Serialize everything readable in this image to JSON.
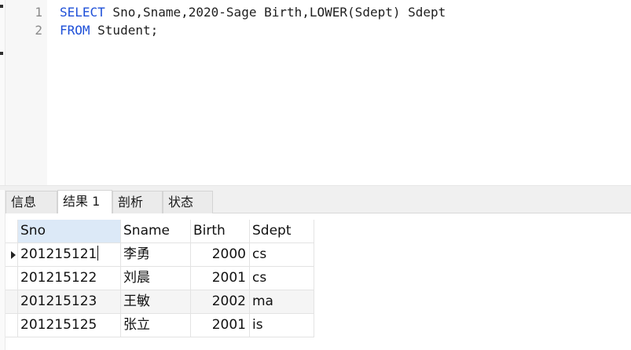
{
  "editor": {
    "line_numbers": [
      "1",
      "2"
    ],
    "lines": [
      {
        "tokens": [
          {
            "text": "SELECT",
            "kind": "keyword"
          },
          {
            "text": " Sno,Sname,2020-Sage Birth,LOWER(Sdept) Sdept",
            "kind": "plain"
          }
        ]
      },
      {
        "tokens": [
          {
            "text": "FROM",
            "kind": "keyword"
          },
          {
            "text": " Student;",
            "kind": "plain"
          }
        ]
      }
    ]
  },
  "tabs": [
    {
      "label": "信息",
      "active": false
    },
    {
      "label": "结果 1",
      "active": true
    },
    {
      "label": "剖析",
      "active": false
    },
    {
      "label": "状态",
      "active": false
    }
  ],
  "grid": {
    "columns": [
      "Sno",
      "Sname",
      "Birth",
      "Sdept"
    ],
    "rows": [
      {
        "sno": "201215121",
        "sname": "李勇",
        "birth": "2000",
        "sdept": "cs",
        "current": true
      },
      {
        "sno": "201215122",
        "sname": "刘晨",
        "birth": "2001",
        "sdept": "cs",
        "current": false
      },
      {
        "sno": "201215123",
        "sname": "王敏",
        "birth": "2002",
        "sdept": "ma",
        "current": false
      },
      {
        "sno": "201215125",
        "sname": "张立",
        "birth": "2001",
        "sdept": "is",
        "current": false
      }
    ]
  },
  "colors": {
    "keyword": "#1d4fd8",
    "selected_header": "#dce9f7",
    "alt_row": "#f5f5f5"
  },
  "icons": {
    "row_indicator": "current-row-arrow-icon"
  }
}
